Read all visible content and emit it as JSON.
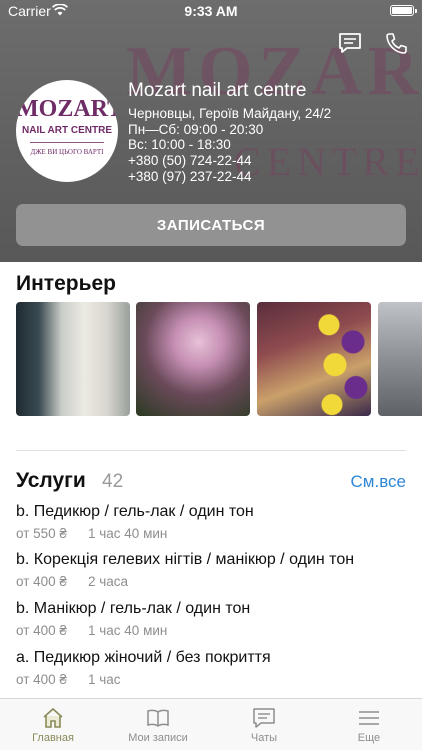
{
  "status_bar": {
    "carrier": "Carrier",
    "time": "9:33 AM"
  },
  "logo": {
    "brand": "MOZART",
    "subtitle": "NAIL ART CENTRE",
    "tagline": "ДЖЕ ВИ ЦЬОГО ВАРТІ"
  },
  "business": {
    "name": "Mozart nail art centre",
    "address": "Черновцы, Героїв Майдану, 24/2",
    "hours_weekdays": "Пн—Сб: 09:00 - 20:30",
    "hours_sunday": "Вс: 10:00 - 18:30",
    "phone_1": "+380 (50) 724-22-44",
    "phone_2": "+380 (97) 237-22-44"
  },
  "book_button": "ЗАПИСАТЬСЯ",
  "interior": {
    "title": "Интерьер"
  },
  "services": {
    "title": "Услуги",
    "count": "42",
    "see_all": "См.все",
    "items": [
      {
        "name": "b. Педикюр / гель-лак / один тон",
        "price": "от 550 ₴",
        "duration": "1 час 40 мин"
      },
      {
        "name": "b. Корекція гелевих нігтів / манікюр / один тон",
        "price": "от 400 ₴",
        "duration": "2 часа"
      },
      {
        "name": "b. Манікюр / гель-лак / один тон",
        "price": "от 400 ₴",
        "duration": "1 час 40 мин"
      },
      {
        "name": "a. Педикюр жіночий / без покриття",
        "price": "от 400 ₴",
        "duration": "1 час"
      }
    ]
  },
  "tabs": [
    {
      "label": "Главная",
      "icon": "home-icon",
      "active": true
    },
    {
      "label": "Мои записи",
      "icon": "book-icon",
      "active": false
    },
    {
      "label": "Чаты",
      "icon": "chat-icon",
      "active": false
    },
    {
      "label": "Еще",
      "icon": "menu-icon",
      "active": false
    }
  ],
  "colors": {
    "accent": "#2e86d6",
    "brand": "#6f2c67",
    "active_tab": "#8a8a5a",
    "button_bg": "#929292"
  }
}
